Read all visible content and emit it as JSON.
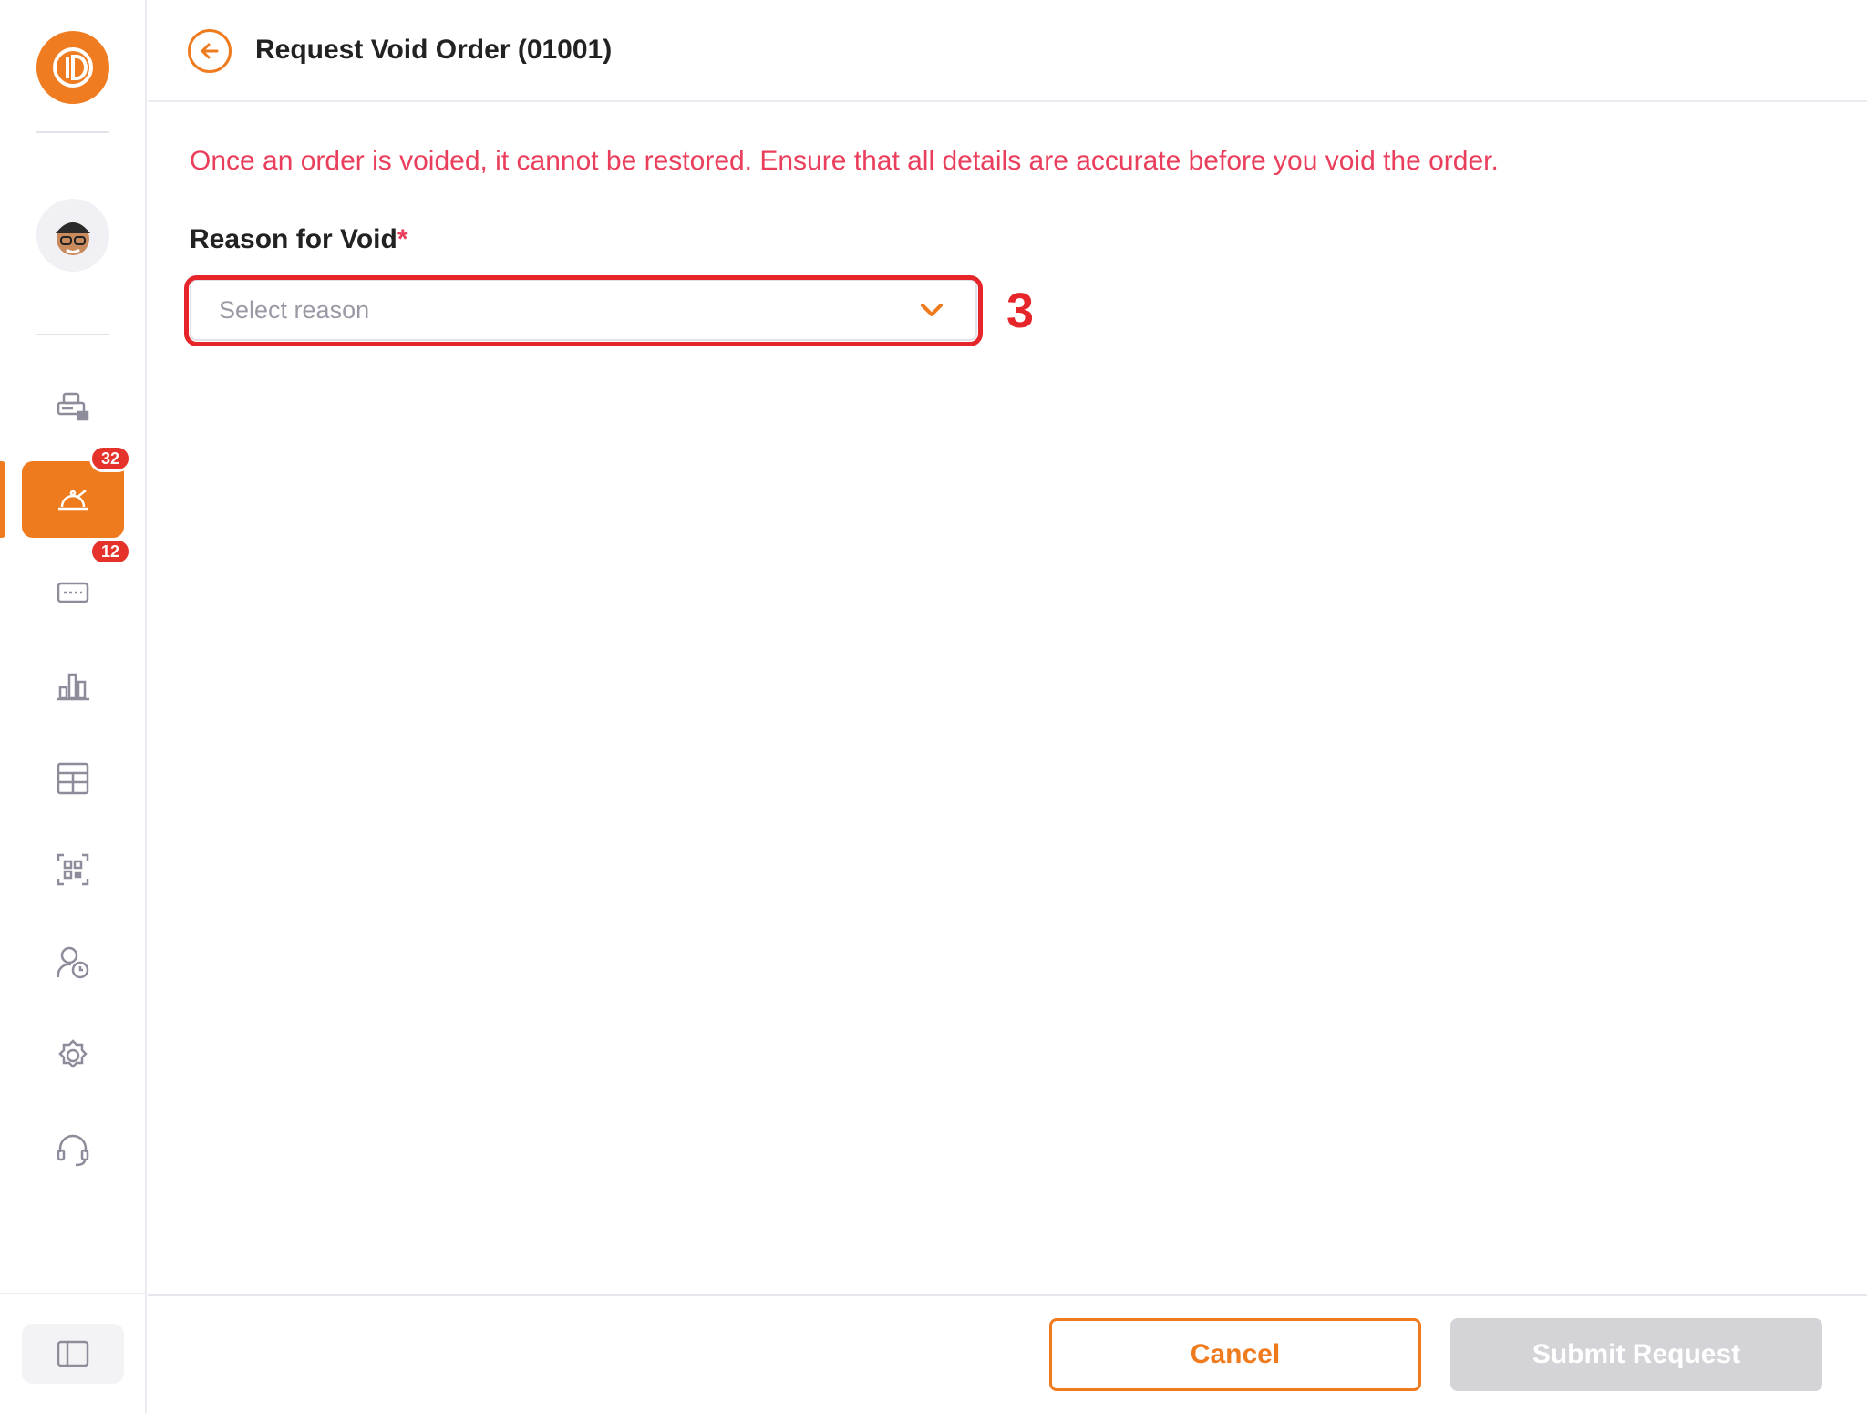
{
  "header": {
    "title": "Request Void Order (01001)",
    "back_icon": "arrow-left-icon"
  },
  "sidebar": {
    "logo_icon": "restaurant-logo-icon",
    "avatar_icon": "user-avatar-icon",
    "items": [
      {
        "name": "pos-terminal",
        "icon": "pos-icon",
        "active": false
      },
      {
        "name": "orders",
        "icon": "serving-dish-icon",
        "active": true,
        "badge": "32"
      },
      {
        "name": "reservations",
        "icon": "ticket-icon",
        "active": false,
        "badge": "12"
      },
      {
        "name": "reports",
        "icon": "bar-chart-icon",
        "active": false
      },
      {
        "name": "tables",
        "icon": "grid-list-icon",
        "active": false
      },
      {
        "name": "qr-scan",
        "icon": "qr-code-icon",
        "active": false
      },
      {
        "name": "staff",
        "icon": "user-clock-icon",
        "active": false
      },
      {
        "name": "settings",
        "icon": "gear-icon",
        "active": false
      },
      {
        "name": "support",
        "icon": "headset-icon",
        "active": false
      }
    ],
    "collapse_icon": "sidebar-toggle-icon"
  },
  "content": {
    "warning": "Once an order is voided, it cannot be restored. Ensure that all details are accurate before you void the order.",
    "reason_label": "Reason for Void",
    "required_mark": "*",
    "reason_placeholder": "Select reason",
    "chevron_icon": "chevron-down-icon"
  },
  "annotation": {
    "step": "3"
  },
  "footer": {
    "cancel_label": "Cancel",
    "submit_label": "Submit Request"
  },
  "colors": {
    "accent": "#ef7b1f",
    "warning_text": "#ea3f5c",
    "badge": "#e5322b",
    "annotation_red": "#e5252a",
    "disabled_button": "#d3d3d8"
  }
}
